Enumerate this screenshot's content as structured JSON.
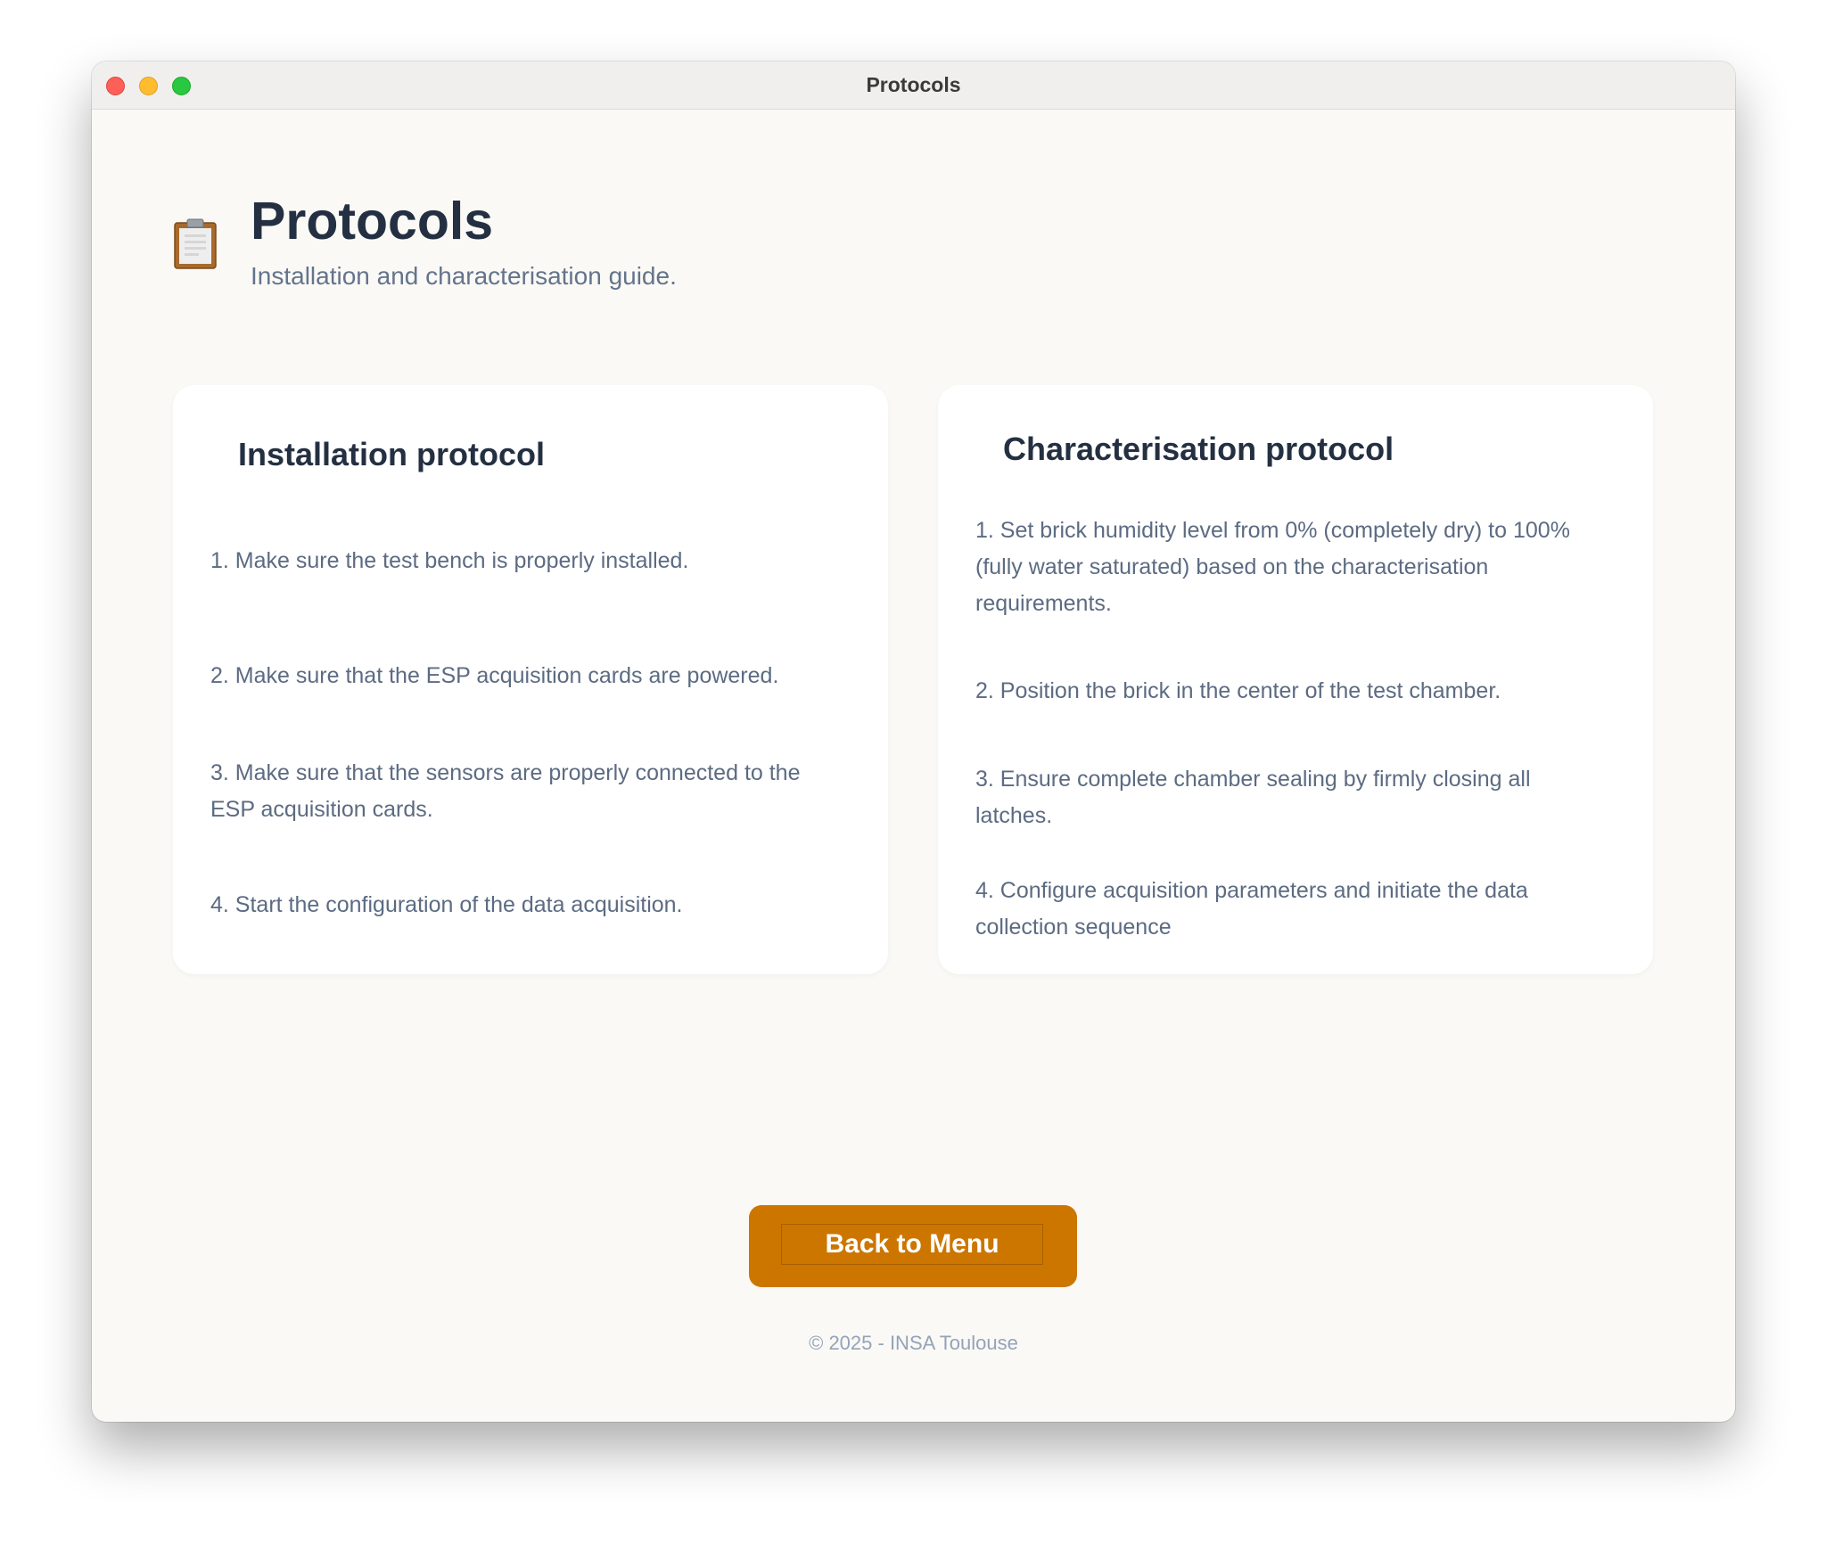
{
  "window": {
    "title": "Protocols"
  },
  "header": {
    "icon": "clipboard-icon",
    "title": "Protocols",
    "subtitle": "Installation and characterisation guide."
  },
  "installation": {
    "title": "Installation protocol",
    "steps": [
      "1. Make sure the test bench is properly installed.",
      "2. Make sure that the ESP acquisition cards are powered.",
      "3. Make sure that the sensors are properly connected to the ESP acquisition cards.",
      "4. Start the configuration of the data acquisition."
    ]
  },
  "characterisation": {
    "title": "Characterisation protocol",
    "steps": [
      "1. Set brick humidity level from 0% (completely dry) to 100% (fully water saturated) based on the characterisation requirements.",
      "2. Position the brick in the center of the test chamber.",
      "3. Ensure complete chamber sealing by firmly closing all latches.",
      "4. Configure acquisition parameters and initiate the data collection sequence"
    ]
  },
  "footer": {
    "back_label": "Back to Menu",
    "copyright": "© 2025 - INSA Toulouse"
  },
  "colors": {
    "accent": "#cc7600",
    "heading": "#243042",
    "body_text": "#5c6b82",
    "background": "#faf9f6"
  }
}
